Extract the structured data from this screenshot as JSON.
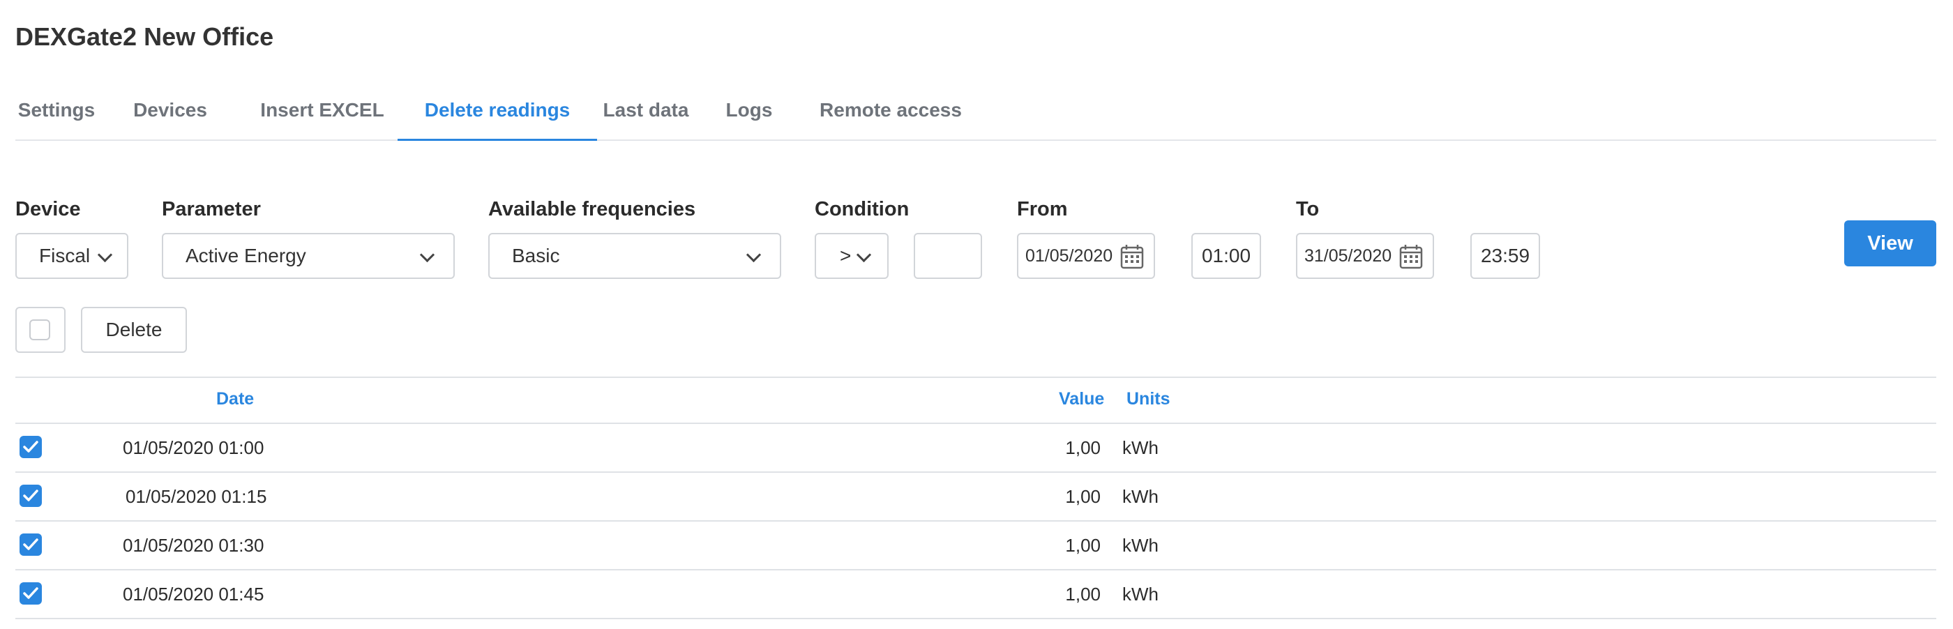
{
  "app": {
    "title": "DEXGate2 New Office"
  },
  "tabs": [
    {
      "label": "Settings",
      "active": false
    },
    {
      "label": "Devices",
      "active": false
    },
    {
      "label": "Insert EXCEL",
      "active": false
    },
    {
      "label": "Delete readings",
      "active": true
    },
    {
      "label": "Last data",
      "active": false
    },
    {
      "label": "Logs",
      "active": false
    },
    {
      "label": "Remote access",
      "active": false
    }
  ],
  "filters": {
    "device": {
      "label": "Device",
      "value": "Fiscal"
    },
    "parameter": {
      "label": "Parameter",
      "value": "Active Energy"
    },
    "frequency": {
      "label": "Available frequencies",
      "value": "Basic"
    },
    "condition": {
      "label": "Condition",
      "value": ">",
      "threshold": ""
    },
    "from": {
      "label": "From",
      "date": "01/05/2020",
      "time": "01:00"
    },
    "to": {
      "label": "To",
      "date": "31/05/2020",
      "time": "23:59"
    },
    "view_label": "View"
  },
  "actions": {
    "select_all_checked": false,
    "delete_label": "Delete"
  },
  "table": {
    "headers": {
      "date": "Date",
      "value": "Value",
      "units": "Units"
    },
    "rows": [
      {
        "checked": true,
        "date": "01/05/2020 01:00",
        "value": "1,00",
        "units": "kWh"
      },
      {
        "checked": true,
        "date": "01/05/2020 01:15",
        "value": "1,00",
        "units": "kWh"
      },
      {
        "checked": true,
        "date": "01/05/2020 01:30",
        "value": "1,00",
        "units": "kWh"
      },
      {
        "checked": true,
        "date": "01/05/2020 01:45",
        "value": "1,00",
        "units": "kWh"
      }
    ]
  },
  "colors": {
    "accent": "#2a86df",
    "border": "#d2d5d9",
    "tab_inactive": "#6e737a"
  }
}
